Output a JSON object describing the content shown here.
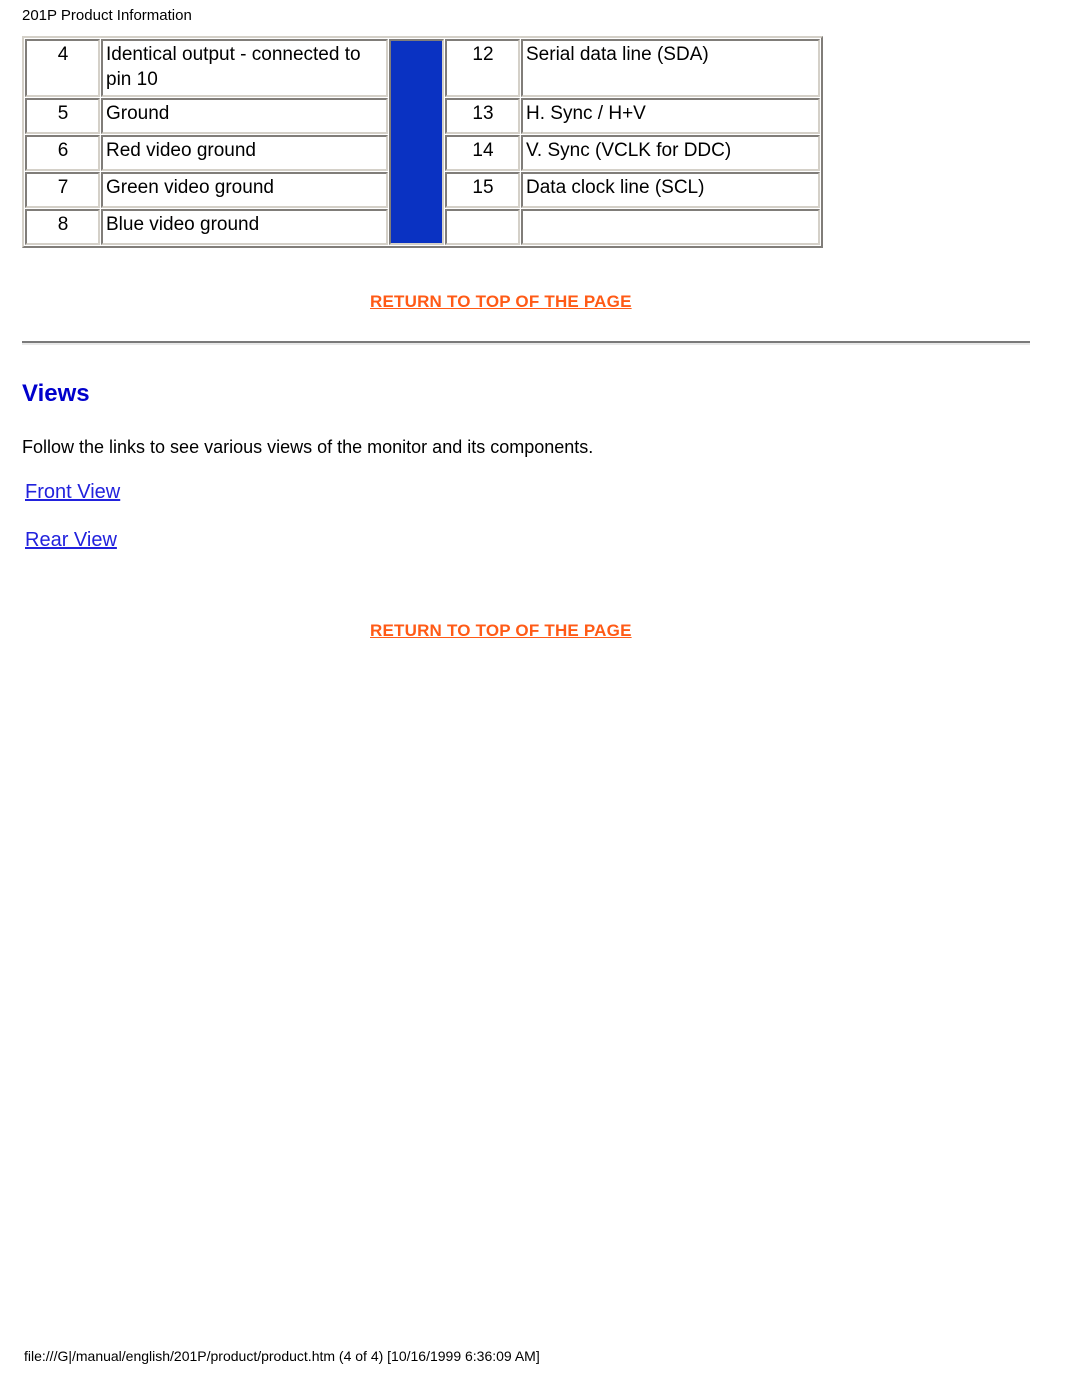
{
  "page": {
    "header_title": "201P Product Information",
    "footer": "file:///G|/manual/english/201P/product/product.htm (4 of 4) [10/16/1999 6:36:09 AM]"
  },
  "colors": {
    "link_blue": "#2222dd",
    "heading_blue": "#0000cc",
    "return_orange": "#ff5a16",
    "spacer_blue": "#0a32c2"
  },
  "pin_table": {
    "rows": [
      {
        "left_num": "4",
        "left_desc": "Identical output - connected to pin 10",
        "right_num": "12",
        "right_desc": "Serial data line (SDA)"
      },
      {
        "left_num": "5",
        "left_desc": "Ground",
        "right_num": "13",
        "right_desc": "H. Sync / H+V"
      },
      {
        "left_num": "6",
        "left_desc": "Red video ground",
        "right_num": "14",
        "right_desc": "V. Sync (VCLK for DDC)"
      },
      {
        "left_num": "7",
        "left_desc": "Green video ground",
        "right_num": "15",
        "right_desc": "Data clock line (SCL)"
      },
      {
        "left_num": "8",
        "left_desc": "Blue video ground",
        "right_num": "",
        "right_desc": ""
      }
    ]
  },
  "return_links": {
    "first": "RETURN TO TOP OF THE PAGE",
    "second": "RETURN TO TOP OF THE PAGE"
  },
  "views_section": {
    "title": "Views",
    "description": "Follow the links to see various views of the monitor and its components.",
    "links": [
      {
        "label": "Front View"
      },
      {
        "label": "Rear View"
      }
    ]
  }
}
